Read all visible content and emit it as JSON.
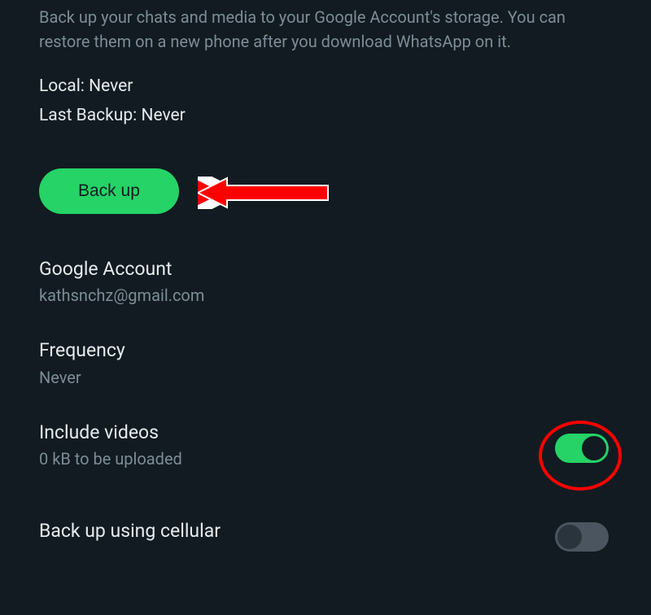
{
  "description": "Back up your chats and media to your Google Account's storage. You can restore them on a new phone after you download WhatsApp on it.",
  "status": {
    "local_label": "Local: Never",
    "last_backup_label": "Last Backup: Never"
  },
  "backup_button_label": "Back up",
  "settings": {
    "google_account": {
      "title": "Google Account",
      "value": "kathsnchz@gmail.com"
    },
    "frequency": {
      "title": "Frequency",
      "value": "Never"
    },
    "include_videos": {
      "title": "Include videos",
      "subtitle": "0 kB to be uploaded",
      "toggle_state": "on"
    },
    "cellular": {
      "title": "Back up using cellular",
      "toggle_state": "off"
    }
  }
}
